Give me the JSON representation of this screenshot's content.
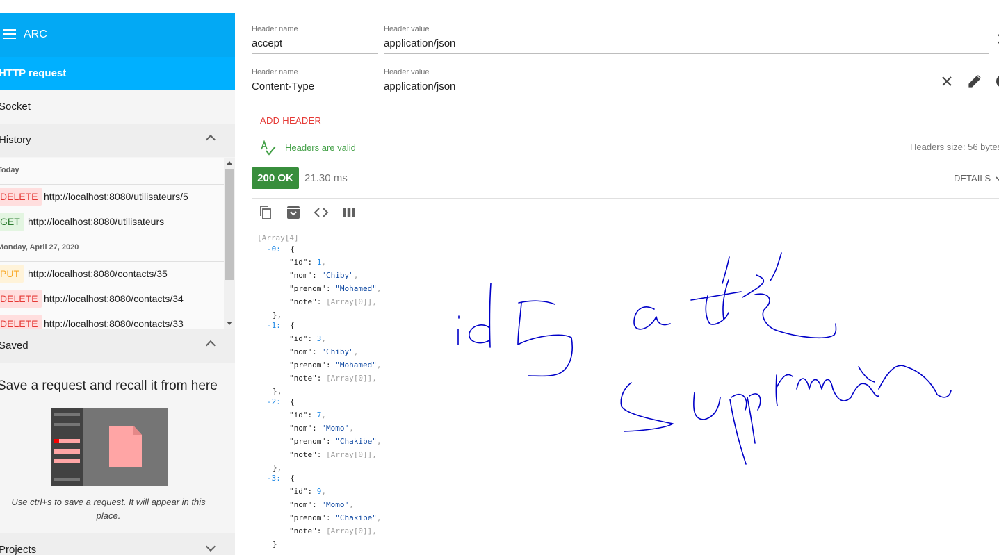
{
  "sidebar": {
    "app_title": "ARC",
    "nav": {
      "http_request": "HTTP request",
      "socket": "Socket"
    },
    "history": {
      "title": "History",
      "groups": [
        {
          "date": "Today",
          "items": [
            {
              "method": "DELETE",
              "url": "http://localhost:8080/utilisateurs/5"
            },
            {
              "method": "GET",
              "url": "http://localhost:8080/utilisateurs"
            }
          ]
        },
        {
          "date": "Monday, April 27, 2020",
          "items": [
            {
              "method": "PUT",
              "url": "http://localhost:8080/contacts/35"
            },
            {
              "method": "DELETE",
              "url": "http://localhost:8080/contacts/34"
            },
            {
              "method": "DELETE",
              "url": "http://localhost:8080/contacts/33"
            }
          ]
        }
      ]
    },
    "saved": {
      "title": "Saved",
      "empty_title": "Save a request and recall it from here",
      "empty_hint": "Use ctrl+s to save a request. It will appear in this place."
    },
    "projects": {
      "title": "Projects"
    }
  },
  "headers": {
    "name_label": "Header name",
    "value_label": "Header value",
    "rows": [
      {
        "name": "accept",
        "value": "application/json"
      },
      {
        "name": "Content-Type",
        "value": "application/json"
      }
    ],
    "add_label": "ADD HEADER",
    "valid_text": "Headers are valid",
    "size_text": "Headers size: 56 bytes"
  },
  "response": {
    "status": "200 OK",
    "time": "21.30 ms",
    "details_label": "DETAILS",
    "json": {
      "root_label": "[Array[4]",
      "items": [
        {
          "index": "-0:",
          "id": "1",
          "nom": "\"Chiby\"",
          "prenom": "\"Mohamed\"",
          "note": "[Array[0]]"
        },
        {
          "index": "-1:",
          "id": "3",
          "nom": "\"Chiby\"",
          "prenom": "\"Mohamed\"",
          "note": "[Array[0]]"
        },
        {
          "index": "-2:",
          "id": "7",
          "nom": "\"Momo\"",
          "prenom": "\"Chakibe\"",
          "note": "[Array[0]]"
        },
        {
          "index": "-3:",
          "id": "9",
          "nom": "\"Momo\"",
          "prenom": "\"Chakibe\"",
          "note": "[Array[0]]"
        }
      ],
      "keys": {
        "id": "\"id\"",
        "nom": "\"nom\"",
        "prenom": "\"prenom\"",
        "note": "\"note\""
      }
    }
  },
  "colors": {
    "header_blue": "#03a9f4",
    "active_blue": "#00b0ff",
    "status_green": "#388e3c",
    "add_red": "#e53935",
    "ink_blue": "#0000c8"
  }
}
